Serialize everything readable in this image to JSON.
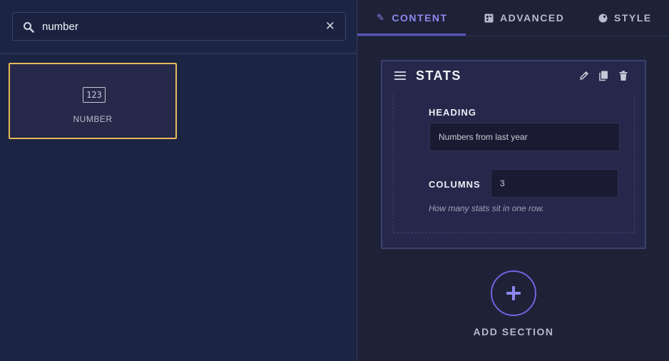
{
  "search": {
    "value": "number"
  },
  "widgets": [
    {
      "icon": "123",
      "label": "NUMBER"
    }
  ],
  "tabs": [
    {
      "label": "CONTENT",
      "icon": "pencil-icon",
      "active": true
    },
    {
      "label": "ADVANCED",
      "icon": "grid-icon",
      "active": false
    },
    {
      "label": "STYLE",
      "icon": "palette-icon",
      "active": false
    }
  ],
  "section": {
    "title": "STATS",
    "fields": {
      "heading": {
        "label": "HEADING",
        "value": "Numbers from last year"
      },
      "columns": {
        "label": "COLUMNS",
        "value": "3",
        "help": "How many stats sit in one row."
      }
    }
  },
  "add_section": {
    "label": "ADD SECTION"
  },
  "colors": {
    "accent": "#8e87f0",
    "selection": "#e8b95a",
    "background": "#1b2442"
  }
}
